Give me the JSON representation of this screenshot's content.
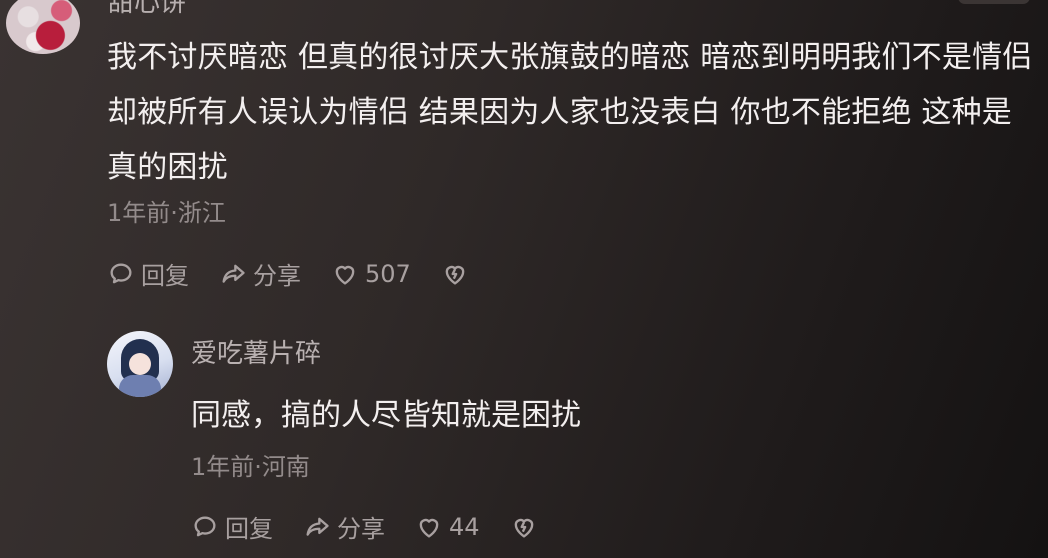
{
  "top_comment": {
    "username": "甜心饼",
    "text": "我不讨厌暗恋 但真的很讨厌大张旗鼓的暗恋 暗恋到明明我们不是情侣 却被所有人误认为情侣 结果因为人家也没表白 你也不能拒绝 这种是真的困扰",
    "meta": "1年前·浙江",
    "actions": {
      "reply_label": "回复",
      "share_label": "分享",
      "like_count": "507"
    }
  },
  "reply": {
    "username": "爱吃薯片碎",
    "text": "同感，搞的人尽皆知就是困扰",
    "meta": "1年前·河南",
    "actions": {
      "reply_label": "回复",
      "share_label": "分享",
      "like_count": "44"
    }
  },
  "icons": {
    "reply": "speech-bubble-icon",
    "share": "share-arrow-icon",
    "like": "heart-outline-icon",
    "dislike": "broken-heart-icon"
  }
}
